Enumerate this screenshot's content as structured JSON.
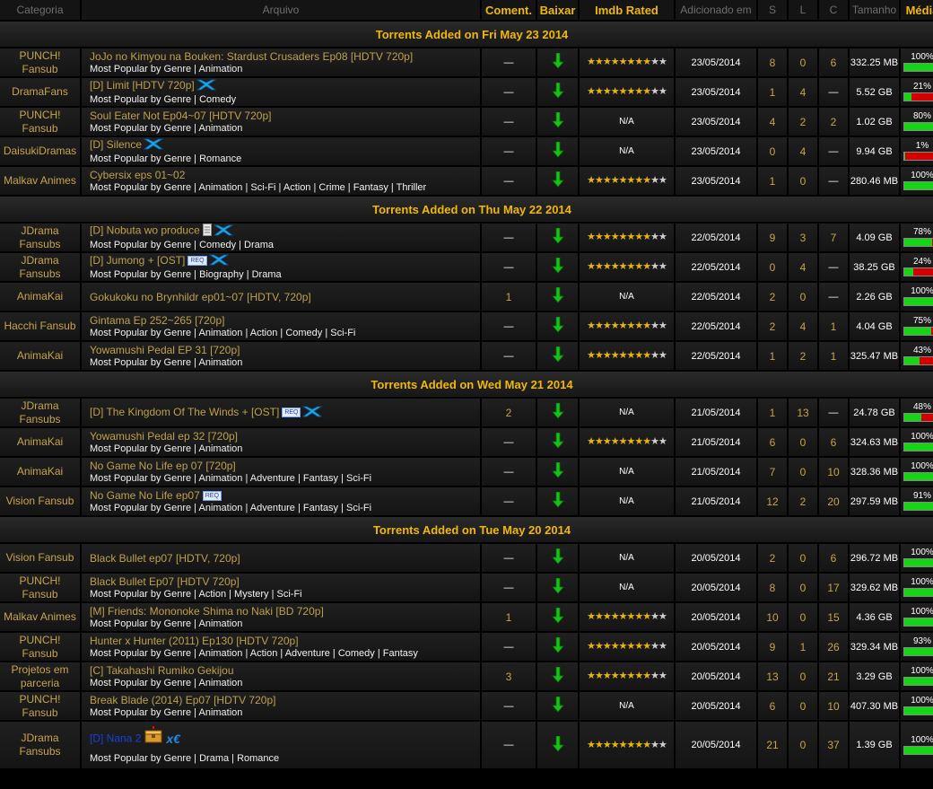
{
  "headers": {
    "categoria": "Categoria",
    "arquivo": "Arquivo",
    "coment": "Coment.",
    "baixar": "Baixar",
    "imdb": "Imdb Rated",
    "adicionado": "Adicionado em",
    "s": "S",
    "l": "L",
    "c": "C",
    "tamanho": "Tamanho",
    "media": "Média"
  },
  "meta_prefix": "Most Popular by Genre",
  "colors": {
    "accent": "#f2b800",
    "title": "#bfa049",
    "health_good": "#16d416",
    "health_bad": "#d40000"
  },
  "groups": [
    {
      "label": "Torrents Added on Fri May 23 2014",
      "rows": [
        {
          "cat": "PUNCH! Fansub",
          "title": "JoJo no Kimyou na Bouken: Stardust Crusaders Ep08 [HDTV 720p]",
          "genres": "Animation",
          "coment": "—",
          "imdb": 8,
          "date": "23/05/2014",
          "s": "8",
          "l": "0",
          "c": "6",
          "size": "332.25 MB",
          "health": 100,
          "icons": []
        },
        {
          "cat": "DramaFans",
          "title": "[D] Limit [HDTV 720p]",
          "genres": "Comedy",
          "coment": "—",
          "imdb": 8,
          "date": "23/05/2014",
          "s": "1",
          "l": "4",
          "c": "—",
          "size": "5.52 GB",
          "health": 21,
          "icons": [
            "x-icon"
          ]
        },
        {
          "cat": "PUNCH! Fansub",
          "title": "Soul Eater Not Ep04~07 [HDTV 720p]",
          "genres": "Animation",
          "coment": "—",
          "imdb": "N/A",
          "date": "23/05/2014",
          "s": "4",
          "l": "2",
          "c": "2",
          "size": "1.02 GB",
          "health": 80,
          "icons": []
        },
        {
          "cat": "DaisukiDramas",
          "title": "[D] Silence",
          "genres": "Romance",
          "coment": "—",
          "imdb": "N/A",
          "date": "23/05/2014",
          "s": "0",
          "l": "4",
          "c": "—",
          "size": "9.94 GB",
          "health": 1,
          "icons": [
            "x-icon"
          ]
        },
        {
          "cat": "Malkav Animes",
          "title": "Cybersix eps 01~02",
          "genres": "Animation | Sci-Fi | Action | Crime | Fantasy | Thriller",
          "coment": "—",
          "imdb": 8,
          "date": "23/05/2014",
          "s": "1",
          "l": "0",
          "c": "—",
          "size": "280.46 MB",
          "health": 100,
          "icons": []
        }
      ]
    },
    {
      "label": "Torrents Added on Thu May 22 2014",
      "rows": [
        {
          "cat": "JDrama Fansubs",
          "title": "[D] Nobuta wo produce",
          "genres": "Comedy | Drama",
          "coment": "—",
          "imdb": 8,
          "date": "22/05/2014",
          "s": "9",
          "l": "3",
          "c": "7",
          "size": "4.09 GB",
          "health": 78,
          "icons": [
            "file-icon",
            "x-icon"
          ]
        },
        {
          "cat": "JDrama Fansubs",
          "title": "[D] Jumong + [OST]",
          "genres": "Biography | Drama",
          "coment": "—",
          "imdb": 8,
          "date": "22/05/2014",
          "s": "0",
          "l": "4",
          "c": "—",
          "size": "38.25 GB",
          "health": 24,
          "icons": [
            "req-badge",
            "x-icon"
          ]
        },
        {
          "cat": "AnimaKai",
          "title": "Gokukoku no Brynhildr ep01~07 [HDTV, 720p]",
          "genres": "",
          "coment": "1",
          "imdb": "N/A",
          "date": "22/05/2014",
          "s": "2",
          "l": "0",
          "c": "—",
          "size": "2.26 GB",
          "health": 100,
          "icons": []
        },
        {
          "cat": "Hacchi Fansub",
          "title": "Gintama Ep 252~265 [720p]",
          "genres": "Animation | Action | Comedy | Sci-Fi",
          "coment": "—",
          "imdb": 8,
          "date": "22/05/2014",
          "s": "2",
          "l": "4",
          "c": "1",
          "size": "4.04 GB",
          "health": 75,
          "icons": []
        },
        {
          "cat": "AnimaKai",
          "title": "Yowamushi Pedal EP 31 [720p]",
          "genres": "Animation",
          "coment": "—",
          "imdb": 8,
          "date": "22/05/2014",
          "s": "1",
          "l": "2",
          "c": "1",
          "size": "325.47 MB",
          "health": 43,
          "icons": []
        }
      ]
    },
    {
      "label": "Torrents Added on Wed May 21 2014",
      "rows": [
        {
          "cat": "JDrama Fansubs",
          "title": "[D] The Kingdom Of The Winds + [OST]",
          "genres": "",
          "coment": "2",
          "imdb": "N/A",
          "date": "21/05/2014",
          "s": "1",
          "l": "13",
          "c": "—",
          "size": "24.78 GB",
          "health": 48,
          "icons": [
            "req-badge",
            "x-icon"
          ]
        },
        {
          "cat": "AnimaKai",
          "title": "Yowamushi Pedal ep 32 [720p]",
          "genres": "Animation",
          "coment": "—",
          "imdb": 8,
          "date": "21/05/2014",
          "s": "6",
          "l": "0",
          "c": "6",
          "size": "324.63 MB",
          "health": 100,
          "icons": []
        },
        {
          "cat": "AnimaKai",
          "title": "No Game No Life ep 07 [720p]",
          "genres": "Animation | Adventure | Fantasy | Sci-Fi",
          "coment": "—",
          "imdb": "N/A",
          "date": "21/05/2014",
          "s": "7",
          "l": "0",
          "c": "10",
          "size": "328.36 MB",
          "health": 100,
          "icons": []
        },
        {
          "cat": "Vision Fansub",
          "title": "No Game No Life ep07",
          "genres": "Animation | Adventure | Fantasy | Sci-Fi",
          "coment": "—",
          "imdb": "N/A",
          "date": "21/05/2014",
          "s": "12",
          "l": "2",
          "c": "20",
          "size": "297.59 MB",
          "health": 91,
          "icons": [
            "req-badge"
          ]
        }
      ]
    },
    {
      "label": "Torrents Added on Tue May 20 2014",
      "rows": [
        {
          "cat": "Vision Fansub",
          "title": "Black Bullet ep07 [HDTV, 720p]",
          "genres": "",
          "coment": "—",
          "imdb": "N/A",
          "date": "20/05/2014",
          "s": "2",
          "l": "0",
          "c": "6",
          "size": "296.72 MB",
          "health": 100,
          "icons": []
        },
        {
          "cat": "PUNCH! Fansub",
          "title": "Black Bullet Ep07 [HDTV 720p]",
          "genres": "Action | Mystery | Sci-Fi",
          "coment": "—",
          "imdb": "N/A",
          "date": "20/05/2014",
          "s": "8",
          "l": "0",
          "c": "17",
          "size": "329.62 MB",
          "health": 100,
          "icons": []
        },
        {
          "cat": "Malkav Animes",
          "title": "[M] Friends: Mononoke Shima no Naki [BD 720p]",
          "genres": "Animation",
          "coment": "1",
          "imdb": 8,
          "date": "20/05/2014",
          "s": "10",
          "l": "0",
          "c": "15",
          "size": "4.36 GB",
          "health": 100,
          "icons": []
        },
        {
          "cat": "PUNCH! Fansub",
          "title": "Hunter x Hunter (2011) Ep130 [HDTV 720p]",
          "genres": "Animation | Action | Adventure | Comedy | Fantasy",
          "coment": "—",
          "imdb": 8,
          "date": "20/05/2014",
          "s": "9",
          "l": "1",
          "c": "26",
          "size": "329.34 MB",
          "health": 93,
          "icons": []
        },
        {
          "cat": "Projetos em parceria",
          "title": "[C] Takahashi Rumiko Gekijou",
          "genres": "Animation",
          "coment": "3",
          "imdb": 8,
          "date": "20/05/2014",
          "s": "13",
          "l": "0",
          "c": "21",
          "size": "3.29 GB",
          "health": 100,
          "icons": []
        },
        {
          "cat": "PUNCH! Fansub",
          "title": "Break Blade (2014) Ep07 [HDTV 720p]",
          "genres": "Animation",
          "coment": "—",
          "imdb": "N/A",
          "date": "20/05/2014",
          "s": "6",
          "l": "0",
          "c": "10",
          "size": "407.30 MB",
          "health": 100,
          "icons": []
        },
        {
          "cat": "JDrama Fansubs",
          "title": "[D] Nana 2",
          "genres": "Drama | Romance",
          "coment": "—",
          "imdb": 8,
          "date": "20/05/2014",
          "s": "21",
          "l": "0",
          "c": "37",
          "size": "1.39 GB",
          "health": 100,
          "icons": [
            "chest-icon",
            "xe-icon"
          ],
          "tall": true,
          "blue": true
        }
      ]
    }
  ]
}
